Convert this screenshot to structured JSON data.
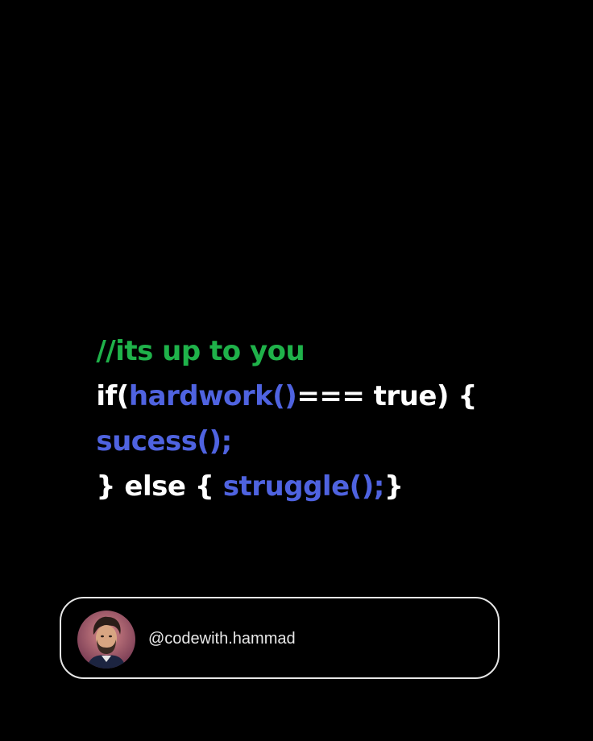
{
  "code": {
    "comment": "//its up to you",
    "line2": {
      "prefix": "if(",
      "call": "hardwork()",
      "suffix": "=== true) {"
    },
    "line3": {
      "call": "sucess();"
    },
    "line4": {
      "prefix": "} else { ",
      "call": "struggle();",
      "suffix": "}"
    }
  },
  "profile": {
    "handle": "@codewith.hammad",
    "avatar_icon": "user-avatar-illustration"
  },
  "colors": {
    "background": "#000000",
    "comment": "#1fb24a",
    "function": "#4f63e0",
    "text": "#ffffff",
    "card_border": "#e6e6e6"
  }
}
